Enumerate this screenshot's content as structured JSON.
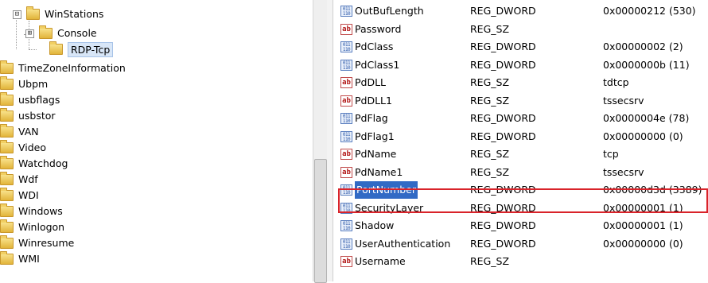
{
  "tree": {
    "items": [
      {
        "label": "WinStations",
        "expander": "⊟"
      },
      {
        "label": "Console",
        "expander": "⊞"
      },
      {
        "label": "RDP-Tcp"
      },
      {
        "label": "TimeZoneInformation"
      },
      {
        "label": "Ubpm"
      },
      {
        "label": "usbflags"
      },
      {
        "label": "usbstor"
      },
      {
        "label": "VAN"
      },
      {
        "label": "Video"
      },
      {
        "label": "Watchdog"
      },
      {
        "label": "Wdf"
      },
      {
        "label": "WDI"
      },
      {
        "label": "Windows"
      },
      {
        "label": "Winlogon"
      },
      {
        "label": "Winresume"
      },
      {
        "label": "WMI"
      }
    ]
  },
  "values": [
    {
      "name": "OutBufLength",
      "type": "REG_DWORD",
      "data": "0x00000212 (530)",
      "icon": "binary-value-icon"
    },
    {
      "name": "Password",
      "type": "REG_SZ",
      "data": "",
      "icon": "string-value-icon"
    },
    {
      "name": "PdClass",
      "type": "REG_DWORD",
      "data": "0x00000002 (2)",
      "icon": "binary-value-icon"
    },
    {
      "name": "PdClass1",
      "type": "REG_DWORD",
      "data": "0x0000000b (11)",
      "icon": "binary-value-icon"
    },
    {
      "name": "PdDLL",
      "type": "REG_SZ",
      "data": "tdtcp",
      "icon": "string-value-icon"
    },
    {
      "name": "PdDLL1",
      "type": "REG_SZ",
      "data": "tssecsrv",
      "icon": "string-value-icon"
    },
    {
      "name": "PdFlag",
      "type": "REG_DWORD",
      "data": "0x0000004e (78)",
      "icon": "binary-value-icon"
    },
    {
      "name": "PdFlag1",
      "type": "REG_DWORD",
      "data": "0x00000000 (0)",
      "icon": "binary-value-icon"
    },
    {
      "name": "PdName",
      "type": "REG_SZ",
      "data": "tcp",
      "icon": "string-value-icon"
    },
    {
      "name": "PdName1",
      "type": "REG_SZ",
      "data": "tssecsrv",
      "icon": "string-value-icon"
    },
    {
      "name": "PortNumber",
      "type": "REG_DWORD",
      "data": "0x00000d3d (3389)",
      "icon": "binary-value-icon",
      "selected": true
    },
    {
      "name": "SecurityLayer",
      "type": "REG_DWORD",
      "data": "0x00000001 (1)",
      "icon": "binary-value-icon"
    },
    {
      "name": "Shadow",
      "type": "REG_DWORD",
      "data": "0x00000001 (1)",
      "icon": "binary-value-icon"
    },
    {
      "name": "UserAuthentication",
      "type": "REG_DWORD",
      "data": "0x00000000 (0)",
      "icon": "binary-value-icon"
    },
    {
      "name": "Username",
      "type": "REG_SZ",
      "data": "",
      "icon": "string-value-icon"
    }
  ],
  "icon_glyphs": {
    "binary": "011 110",
    "string": "ab"
  },
  "colors": {
    "selection": "#316ac5",
    "highlight_box": "#d9232a"
  }
}
